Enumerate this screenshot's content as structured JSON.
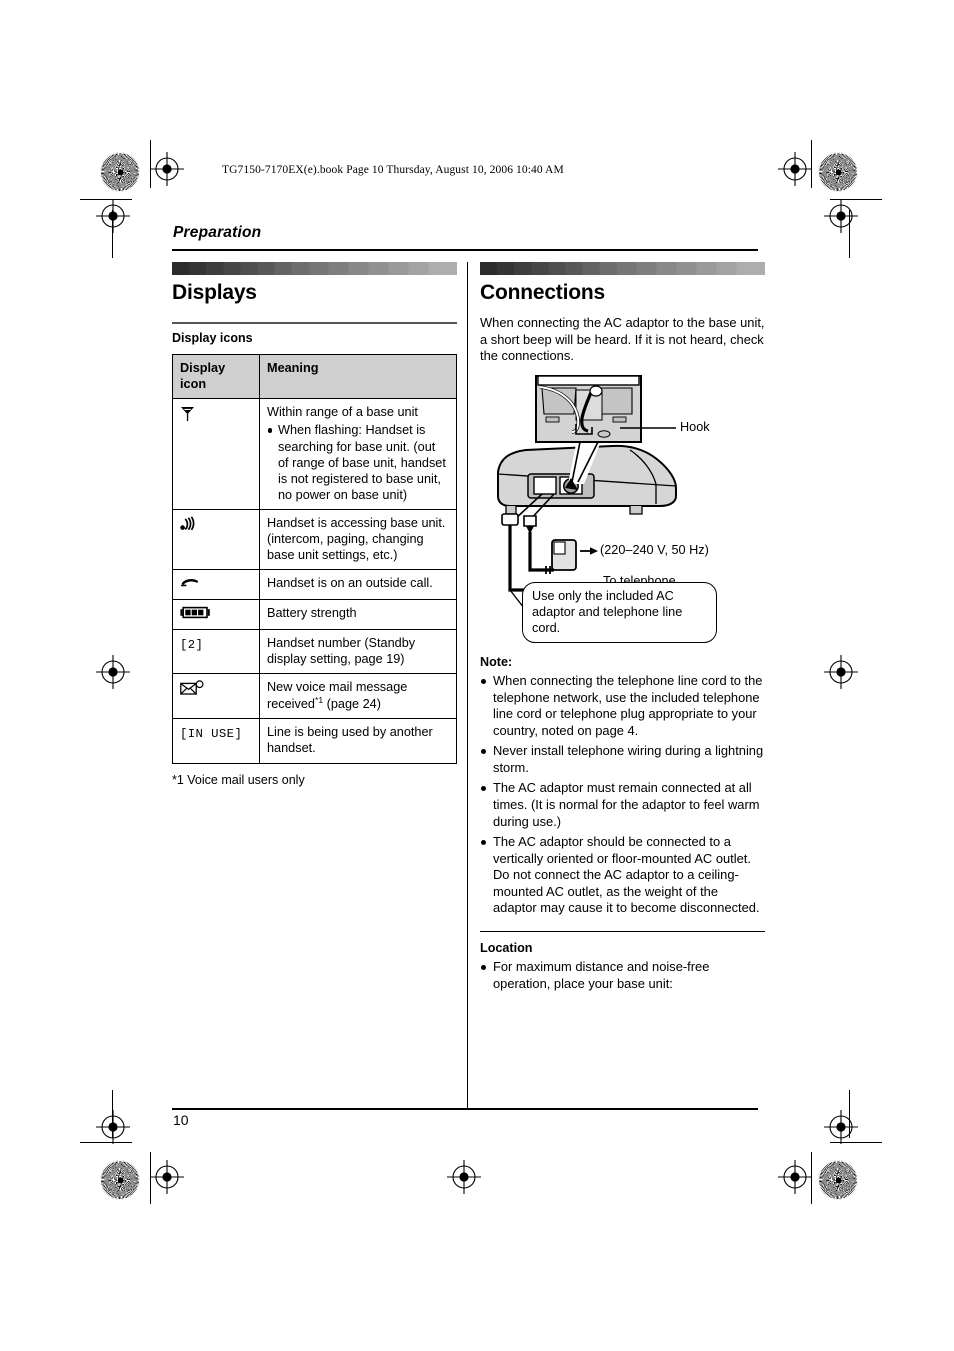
{
  "file_header": "TG7150-7170EX(e).book  Page 10  Thursday, August 10, 2006  10:40 AM",
  "chapter": "Preparation",
  "page_number": "10",
  "left_column": {
    "section_title": "Displays",
    "subhead": "Display icons",
    "table": {
      "headers": [
        "Display icon",
        "Meaning"
      ],
      "rows": [
        {
          "icon_type": "antenna-icon",
          "icon_text": "",
          "meaning": "Within range of a base unit",
          "bullets": [
            "When flashing: Handset is searching for base unit. (out of range of base unit, handset is not registered to base unit, no power on base unit)"
          ]
        },
        {
          "icon_type": "signal-waves-icon",
          "icon_text": "",
          "meaning": "Handset is accessing base unit. (intercom, paging, changing base unit settings, etc.)",
          "bullets": []
        },
        {
          "icon_type": "phone-handset-icon",
          "icon_text": "",
          "meaning": "Handset is on an outside call.",
          "bullets": []
        },
        {
          "icon_type": "battery-icon",
          "icon_text": "",
          "meaning": "Battery strength",
          "bullets": []
        },
        {
          "icon_type": "text-icon",
          "icon_text": "[2]",
          "meaning": "Handset number (Standby display setting, page 19)",
          "bullets": []
        },
        {
          "icon_type": "envelope-icon",
          "icon_text": "",
          "meaning_pre": "New voice mail message received",
          "meaning_footnote": "*1",
          "meaning_post": " (page 24)",
          "meaning": "New voice mail message received*1 (page 24)",
          "bullets": []
        },
        {
          "icon_type": "text-icon",
          "icon_text": "[IN USE]",
          "meaning": "Line is being used by another handset.",
          "bullets": []
        }
      ]
    },
    "footnote": "*1 Voice mail users only"
  },
  "right_column": {
    "section_title": "Connections",
    "intro": "When connecting the AC adaptor to the base unit, a short beep will be heard. If it is not heard, check the connections.",
    "diagram": {
      "hook_label": "Hook",
      "voltage_label": "(220–240 V, 50 Hz)",
      "network_label": "To telephone\nnetwork",
      "callout": "Use only the included AC adaptor and telephone line cord."
    },
    "note_heading": "Note:",
    "notes": [
      "When connecting the telephone line cord to the telephone network, use the included telephone line cord or telephone plug appropriate to your country, noted on page 4.",
      "Never install telephone wiring during a lightning storm.",
      "The AC adaptor must remain connected at all times. (It is normal for the adaptor to feel warm during use.)",
      "The AC adaptor should be connected to a vertically oriented or floor-mounted AC outlet. Do not connect the AC adaptor to a ceiling-mounted AC outlet, as the weight of the adaptor may cause it to become disconnected."
    ],
    "location_heading": "Location",
    "location_notes": [
      "For maximum distance and noise-free operation, place your base unit:"
    ]
  }
}
